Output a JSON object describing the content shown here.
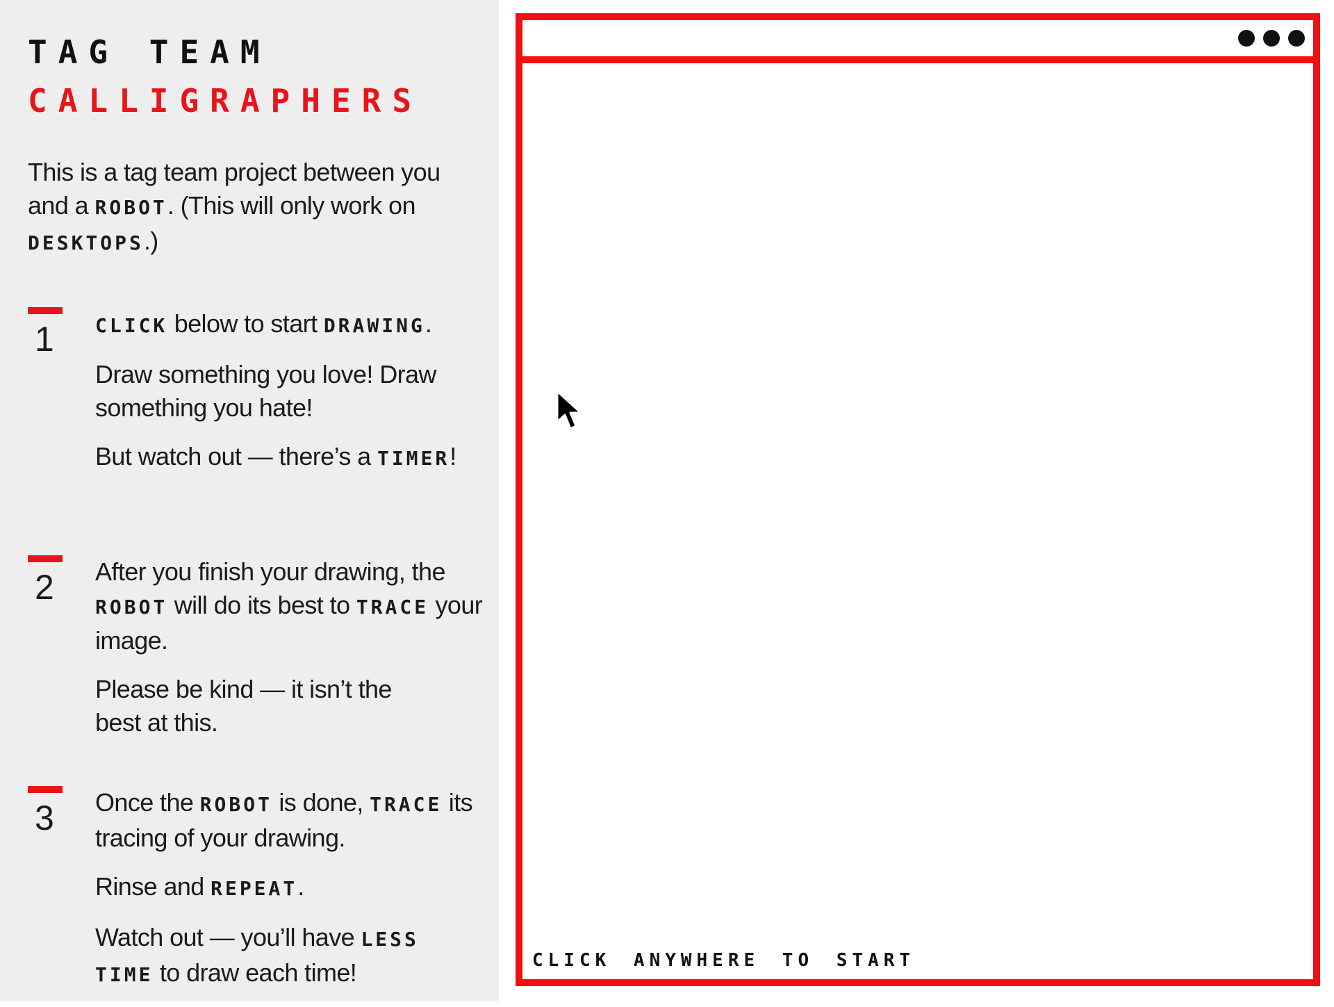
{
  "title": {
    "line1": "Tag Team",
    "line2": "Calligraphers"
  },
  "intro": {
    "text1": "This is a tag team project between you and a ",
    "robot": "robot",
    "text2": ". (This will only work on ",
    "desktops": "desktops",
    "text3": ".)"
  },
  "steps": [
    {
      "number": "1",
      "p1_keyword1": "Click",
      "p1_text1": " below to start ",
      "p1_keyword2": "drawing",
      "p1_text2": ".",
      "p2": "Draw something you love! Draw something you hate!",
      "p3_text1": "But watch out — there’s a ",
      "p3_keyword": "timer",
      "p3_text2": "!"
    },
    {
      "number": "2",
      "p1_text1": "After you finish your drawing, the ",
      "p1_keyword1": "robot",
      "p1_text2": " will do its best to ",
      "p1_keyword2": "trace",
      "p1_text3": " your image.",
      "p2": "Please be kind — it isn’t the best at this."
    },
    {
      "number": "3",
      "p1_text1": "Once the ",
      "p1_keyword1": "robot",
      "p1_text2": " is done, ",
      "p1_keyword2": "trace",
      "p1_text3": " its tracing of your drawing.",
      "p2_text1": "Rinse and ",
      "p2_keyword": "repeat",
      "p2_text2": ".",
      "p3_text1": "Watch out — you’ll have ",
      "p3_keyword1": "less",
      "p3_keyword2": "time",
      "p3_text2": " to draw each time!"
    }
  ],
  "canvas": {
    "start_prompt": "Click anywhere to start",
    "menu_icon": "more-dots-icon",
    "cursor_icon": "mouse-pointer-icon"
  },
  "colors": {
    "accent": "#ee1111",
    "sidebar_bg": "#eeeeee",
    "text": "#1a1a1a"
  }
}
